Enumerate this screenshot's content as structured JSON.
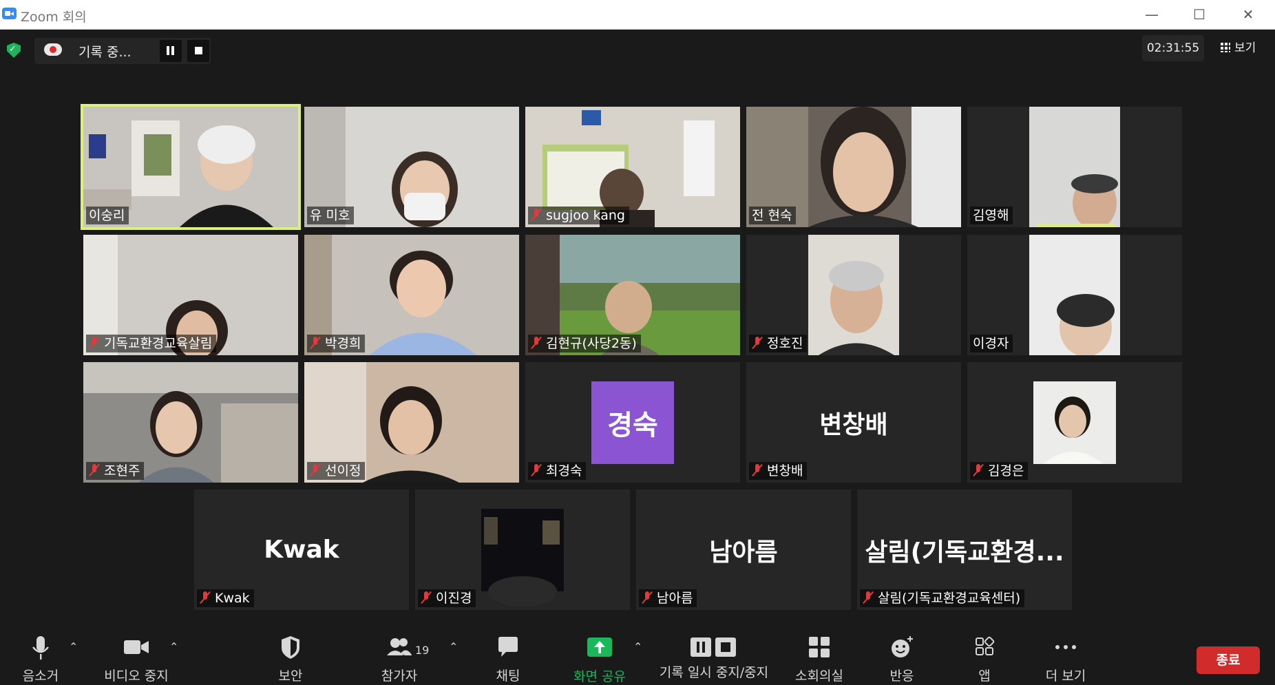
{
  "window": {
    "title": "Zoom 회의",
    "minimize": "—",
    "maximize": "☐",
    "close": "✕"
  },
  "topbar": {
    "recording_text": "기록 중...",
    "timer": "02:31:55",
    "view_label": "보기"
  },
  "participants_grid": [
    {
      "name": "이숭리",
      "muted": false,
      "active_speaker": true,
      "tile_type": "video"
    },
    {
      "name": "유 미호",
      "muted": false,
      "tile_type": "video"
    },
    {
      "name": "sugjoo kang",
      "muted": true,
      "tile_type": "video"
    },
    {
      "name": "전 현숙",
      "muted": false,
      "tile_type": "video"
    },
    {
      "name": "김영해",
      "muted": false,
      "tile_type": "video"
    },
    {
      "name": "기독교환경교육살림",
      "muted": true,
      "tile_type": "video"
    },
    {
      "name": "박경희",
      "muted": true,
      "tile_type": "video"
    },
    {
      "name": "김현규(사당2동)",
      "muted": true,
      "tile_type": "video"
    },
    {
      "name": "정호진",
      "muted": true,
      "tile_type": "video"
    },
    {
      "name": "이경자",
      "muted": false,
      "tile_type": "video"
    },
    {
      "name": "조현주",
      "muted": true,
      "tile_type": "video"
    },
    {
      "name": "선이정",
      "muted": true,
      "tile_type": "video"
    },
    {
      "name": "최경숙",
      "muted": true,
      "tile_type": "avatar",
      "avatar_text": "경숙",
      "avatar_color": "#8b54d3"
    },
    {
      "name": "변창배",
      "muted": true,
      "tile_type": "name",
      "display_text": "변창배"
    },
    {
      "name": "김경은",
      "muted": true,
      "tile_type": "photo"
    },
    {
      "name": "Kwak",
      "muted": true,
      "tile_type": "name",
      "display_text": "Kwak"
    },
    {
      "name": "이진경",
      "muted": true,
      "tile_type": "photo"
    },
    {
      "name": "남아름",
      "muted": true,
      "tile_type": "name",
      "display_text": "남아름"
    },
    {
      "name": "살림(기독교환경교육센터)",
      "muted": true,
      "tile_type": "name",
      "display_text": "살림(기독교환경..."
    }
  ],
  "toolbar": {
    "mute": "음소거",
    "video": "비디오 중지",
    "security": "보안",
    "participants": "참가자",
    "participants_count": "19",
    "chat": "채팅",
    "share": "화면 공유",
    "recording": "기록 일시 중지/중지",
    "breakout": "소회의실",
    "reactions": "반응",
    "apps": "앱",
    "more": "더 보기",
    "end": "종료"
  },
  "colors": {
    "background": "#1a1a1a",
    "tile": "#262626",
    "active_speaker_border": "#d9f07a",
    "share_green": "#1bb85b",
    "end_red": "#d22b2b",
    "muted_red": "#e03a3a"
  }
}
